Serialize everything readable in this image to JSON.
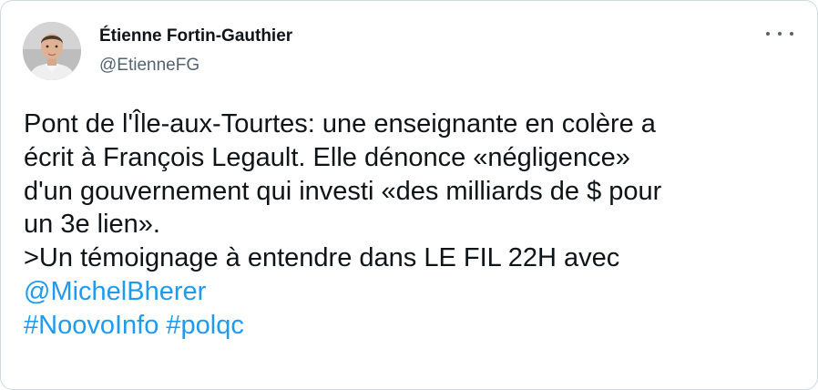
{
  "author": {
    "display_name": "Étienne Fortin-Gauthier",
    "handle": "@EtienneFG"
  },
  "colors": {
    "text": "#0f1419",
    "secondary_text": "#536471",
    "link": "#1d9bf0",
    "border": "#cfd9de"
  },
  "icons": {
    "more": "more-horizontal-icon"
  },
  "tweet": {
    "lines": [
      "Pont de l'Île-aux-Tourtes: une enseignante en colère a",
      "écrit à François Legault. Elle dénonce «négligence»",
      "d'un gouvernement qui investi «des milliards de $ pour",
      "un 3e lien».",
      ">Un témoignage à entendre dans LE FIL 22H avec"
    ],
    "mention": "@MichelBherer",
    "hashtags": [
      "#NoovoInfo",
      "#polqc"
    ]
  }
}
